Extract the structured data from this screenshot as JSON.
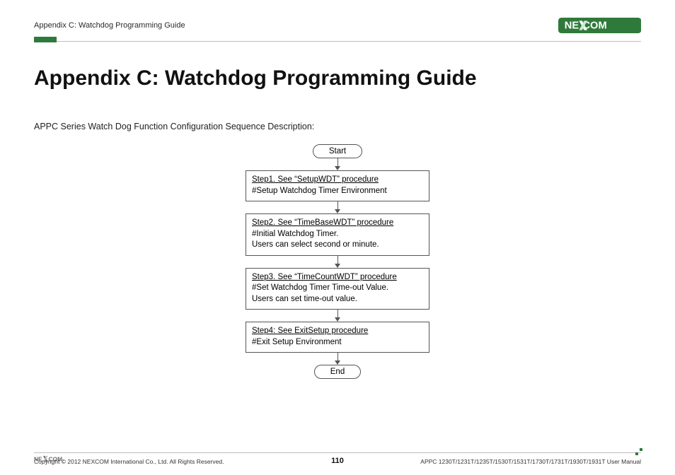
{
  "header": {
    "breadcrumb": "Appendix C: Watchdog Programming Guide"
  },
  "brand": {
    "name": "NEXCOM",
    "pill_bg": "#2f7a3b",
    "pill_fg": "#ffffff"
  },
  "title": "Appendix C: Watchdog Programming Guide",
  "intro": "APPC Series Watch Dog Function Configuration Sequence Description:",
  "flow": {
    "start": "Start",
    "end": "End",
    "steps": [
      {
        "link": "Step1. See “SetupWDT” procedure",
        "body": "#Setup Watchdog Timer Environment"
      },
      {
        "link": "Step2. See “TimeBaseWDT” procedure",
        "body": "#Initial Watchdog Timer.\n Users can select second or minute."
      },
      {
        "link": "Step3. See “TimeCountWDT” procedure",
        "body": "#Set Watchdog Timer Time-out Value.\nUsers can set time-out value."
      },
      {
        "link": "Step4: See ExitSetup procedure",
        "body": "#Exit Setup Environment"
      }
    ]
  },
  "footer": {
    "copyright": "Copyright © 2012 NEXCOM International Co., Ltd. All Rights Reserved.",
    "page_number": "110",
    "doc_ref": "APPC 1230T/1231T/1235T/1530T/1531T/1730T/1731T/1930T/1931T User Manual"
  }
}
